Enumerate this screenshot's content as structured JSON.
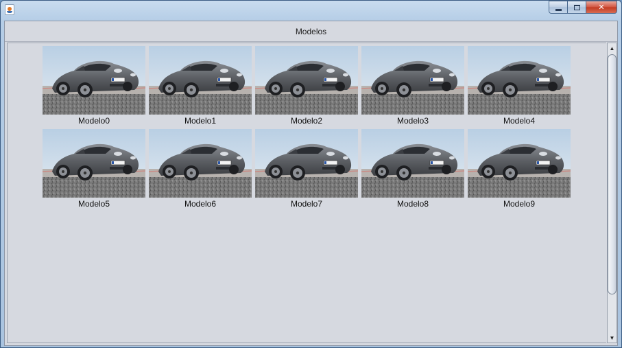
{
  "window": {
    "title": "",
    "icon": "java-coffee-cup-icon",
    "minimize_icon": "minimize-icon",
    "maximize_icon": "maximize-icon",
    "close_icon": "close-icon",
    "close_label": "✕"
  },
  "header": {
    "title": "Modelos"
  },
  "models": [
    {
      "label": "Modelo0"
    },
    {
      "label": "Modelo1"
    },
    {
      "label": "Modelo2"
    },
    {
      "label": "Modelo3"
    },
    {
      "label": "Modelo4"
    },
    {
      "label": "Modelo5"
    },
    {
      "label": "Modelo6"
    },
    {
      "label": "Modelo7"
    },
    {
      "label": "Modelo8"
    },
    {
      "label": "Modelo9"
    }
  ],
  "scrollbar": {
    "up_label": "▲",
    "down_label": "▼"
  },
  "colors": {
    "window_background": "#d6d9e0",
    "titlebar": "#b5cde6",
    "car_body": "#5e6166",
    "sky": "#c7d8e8",
    "ground": "#6a6a6a"
  }
}
